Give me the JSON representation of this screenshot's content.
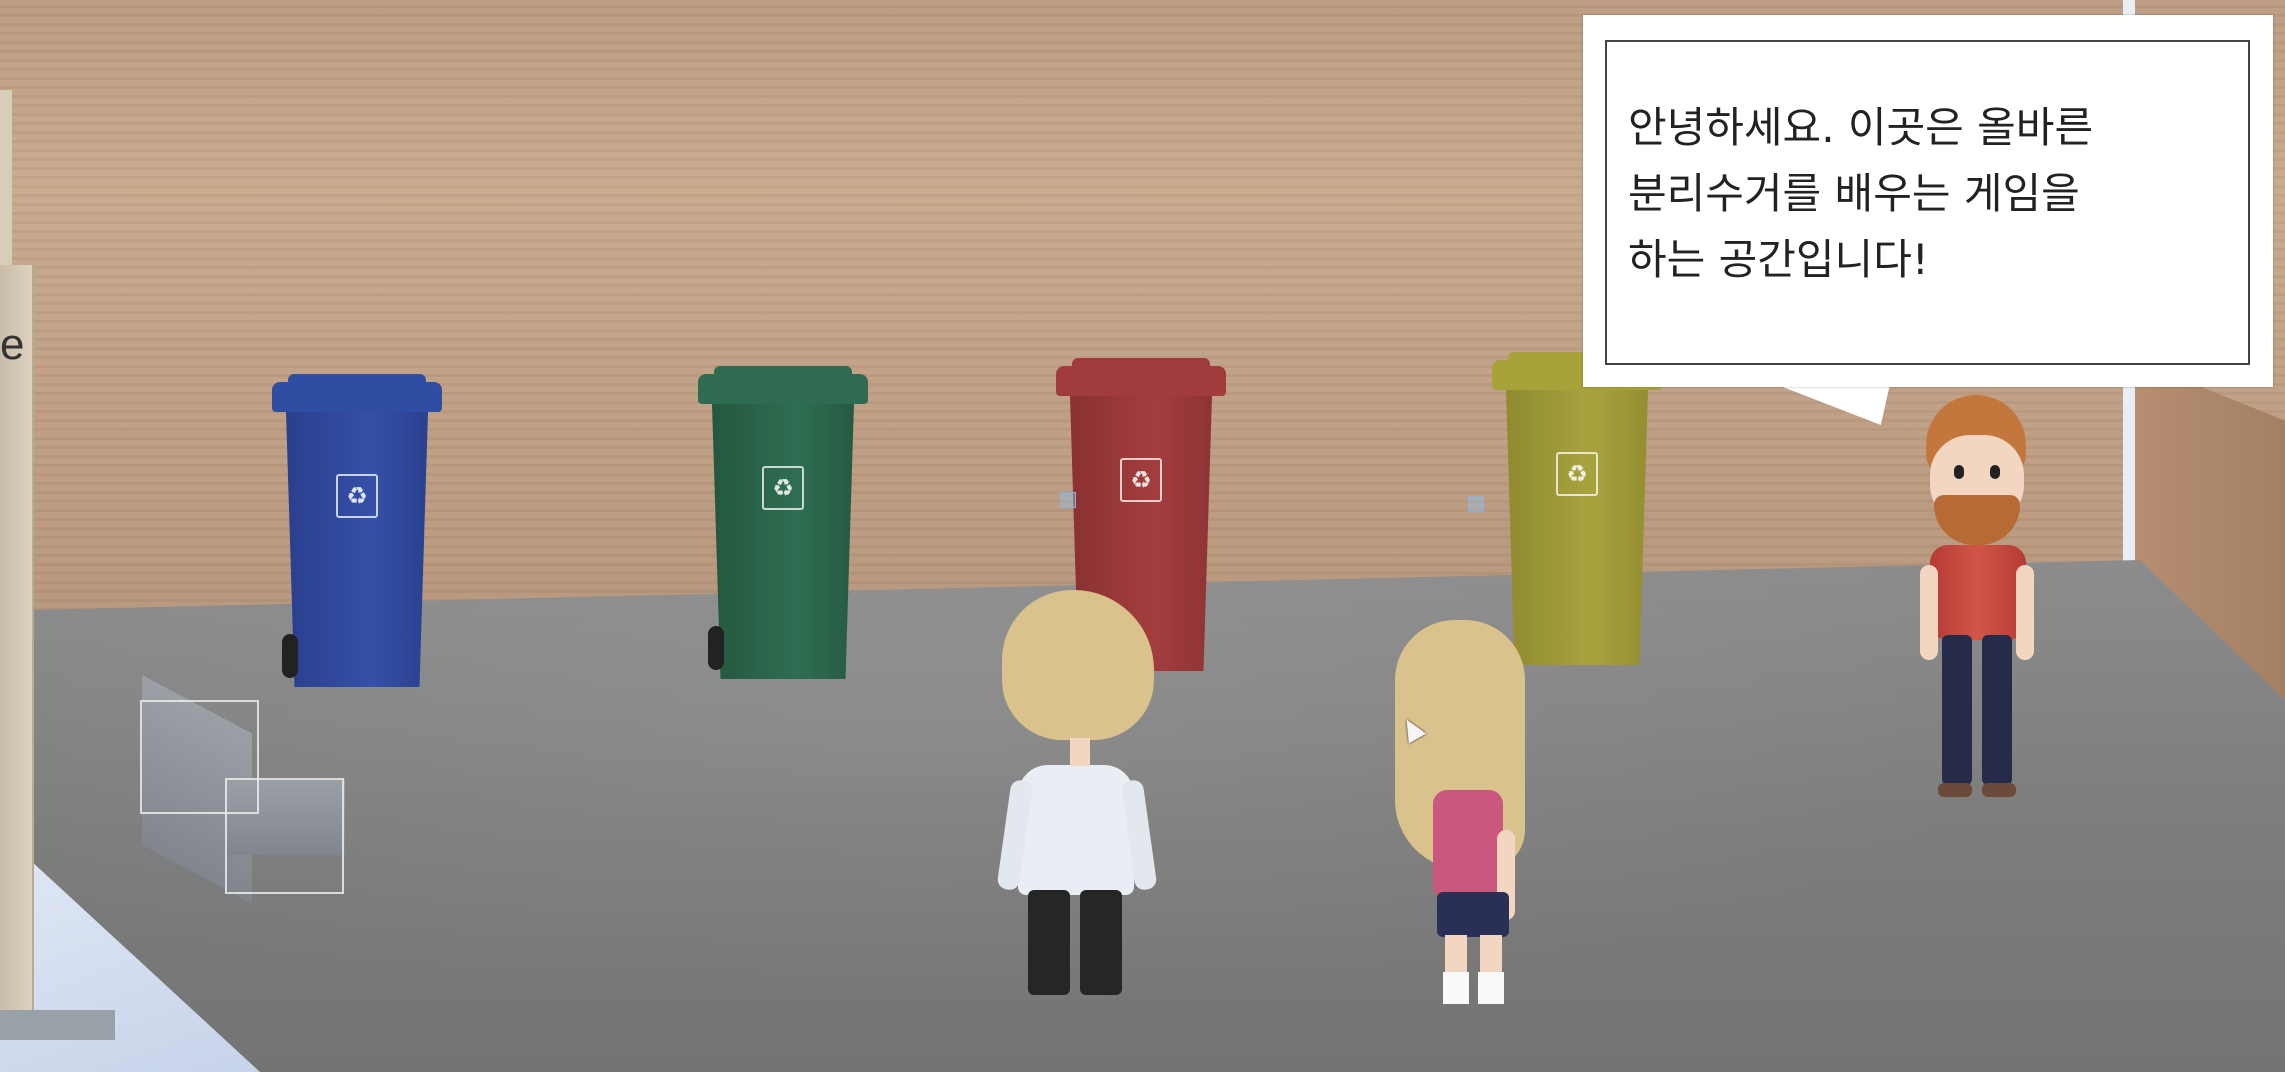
{
  "dialogue": {
    "text": "안녕하세요. 이곳은 올바른\n분리수거를 배우는 게임을\n하는 공간입니다!"
  },
  "left_panel": {
    "letter": "e"
  },
  "bins": [
    {
      "name": "blue-bin",
      "color": "#3550a8"
    },
    {
      "name": "green-bin",
      "color": "#2f6e52"
    },
    {
      "name": "red-bin",
      "color": "#a33d3e"
    },
    {
      "name": "yellow-bin",
      "color": "#a9a33f"
    }
  ],
  "characters": [
    {
      "name": "player-boy"
    },
    {
      "name": "player-girl"
    },
    {
      "name": "npc-bearded-man"
    }
  ],
  "colors": {
    "wall": "#c8a98d",
    "floor": "#7d7d7d",
    "bubble_border": "#444444"
  }
}
